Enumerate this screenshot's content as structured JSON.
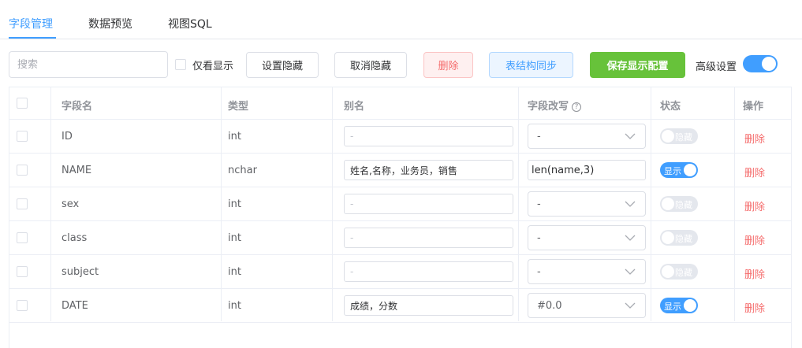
{
  "tabs": [
    {
      "label": "字段管理",
      "active": true
    },
    {
      "label": "数据预览",
      "active": false
    },
    {
      "label": "视图SQL",
      "active": false
    }
  ],
  "toolbar": {
    "search_placeholder": "搜索",
    "only_show_label": "仅看显示",
    "set_hidden_label": "设置隐藏",
    "cancel_hidden_label": "取消隐藏",
    "delete_label": "删除",
    "sync_label": "表结构同步",
    "save_label": "保存显示配置",
    "advanced_label": "高级设置",
    "advanced_on": true
  },
  "table": {
    "columns": {
      "field": "字段名",
      "type": "类型",
      "alias": "别名",
      "rewrite": "字段改写",
      "rewrite_help": "?",
      "status": "状态",
      "action": "操作"
    },
    "rows": [
      {
        "field": "ID",
        "type": "int",
        "alias": "",
        "alias_placeholder": "-",
        "rewrite_mode": "select",
        "rewrite": "-",
        "status": "隐藏",
        "visible": false,
        "action": "删除"
      },
      {
        "field": "NAME",
        "type": "nchar",
        "alias": "姓名,名称，业务员，销售",
        "alias_placeholder": "-",
        "rewrite_mode": "input",
        "rewrite": "len(name,3)",
        "status": "显示",
        "visible": true,
        "action": "删除"
      },
      {
        "field": "sex",
        "type": "int",
        "alias": "",
        "alias_placeholder": "-",
        "rewrite_mode": "select",
        "rewrite": "-",
        "status": "隐藏",
        "visible": false,
        "action": "删除"
      },
      {
        "field": "class",
        "type": "int",
        "alias": "",
        "alias_placeholder": "-",
        "rewrite_mode": "select",
        "rewrite": "-",
        "status": "隐藏",
        "visible": false,
        "action": "删除"
      },
      {
        "field": "subject",
        "type": "int",
        "alias": "",
        "alias_placeholder": "-",
        "rewrite_mode": "select",
        "rewrite": "-",
        "status": "隐藏",
        "visible": false,
        "action": "删除"
      },
      {
        "field": "DATE",
        "type": "int",
        "alias": "成绩，分数",
        "alias_placeholder": "-",
        "rewrite_mode": "select",
        "rewrite": "#0.0",
        "status": "显示",
        "visible": true,
        "action": "删除"
      }
    ]
  },
  "colors": {
    "primary": "#409eff",
    "success": "#67c23a",
    "danger": "#f56c6c"
  }
}
